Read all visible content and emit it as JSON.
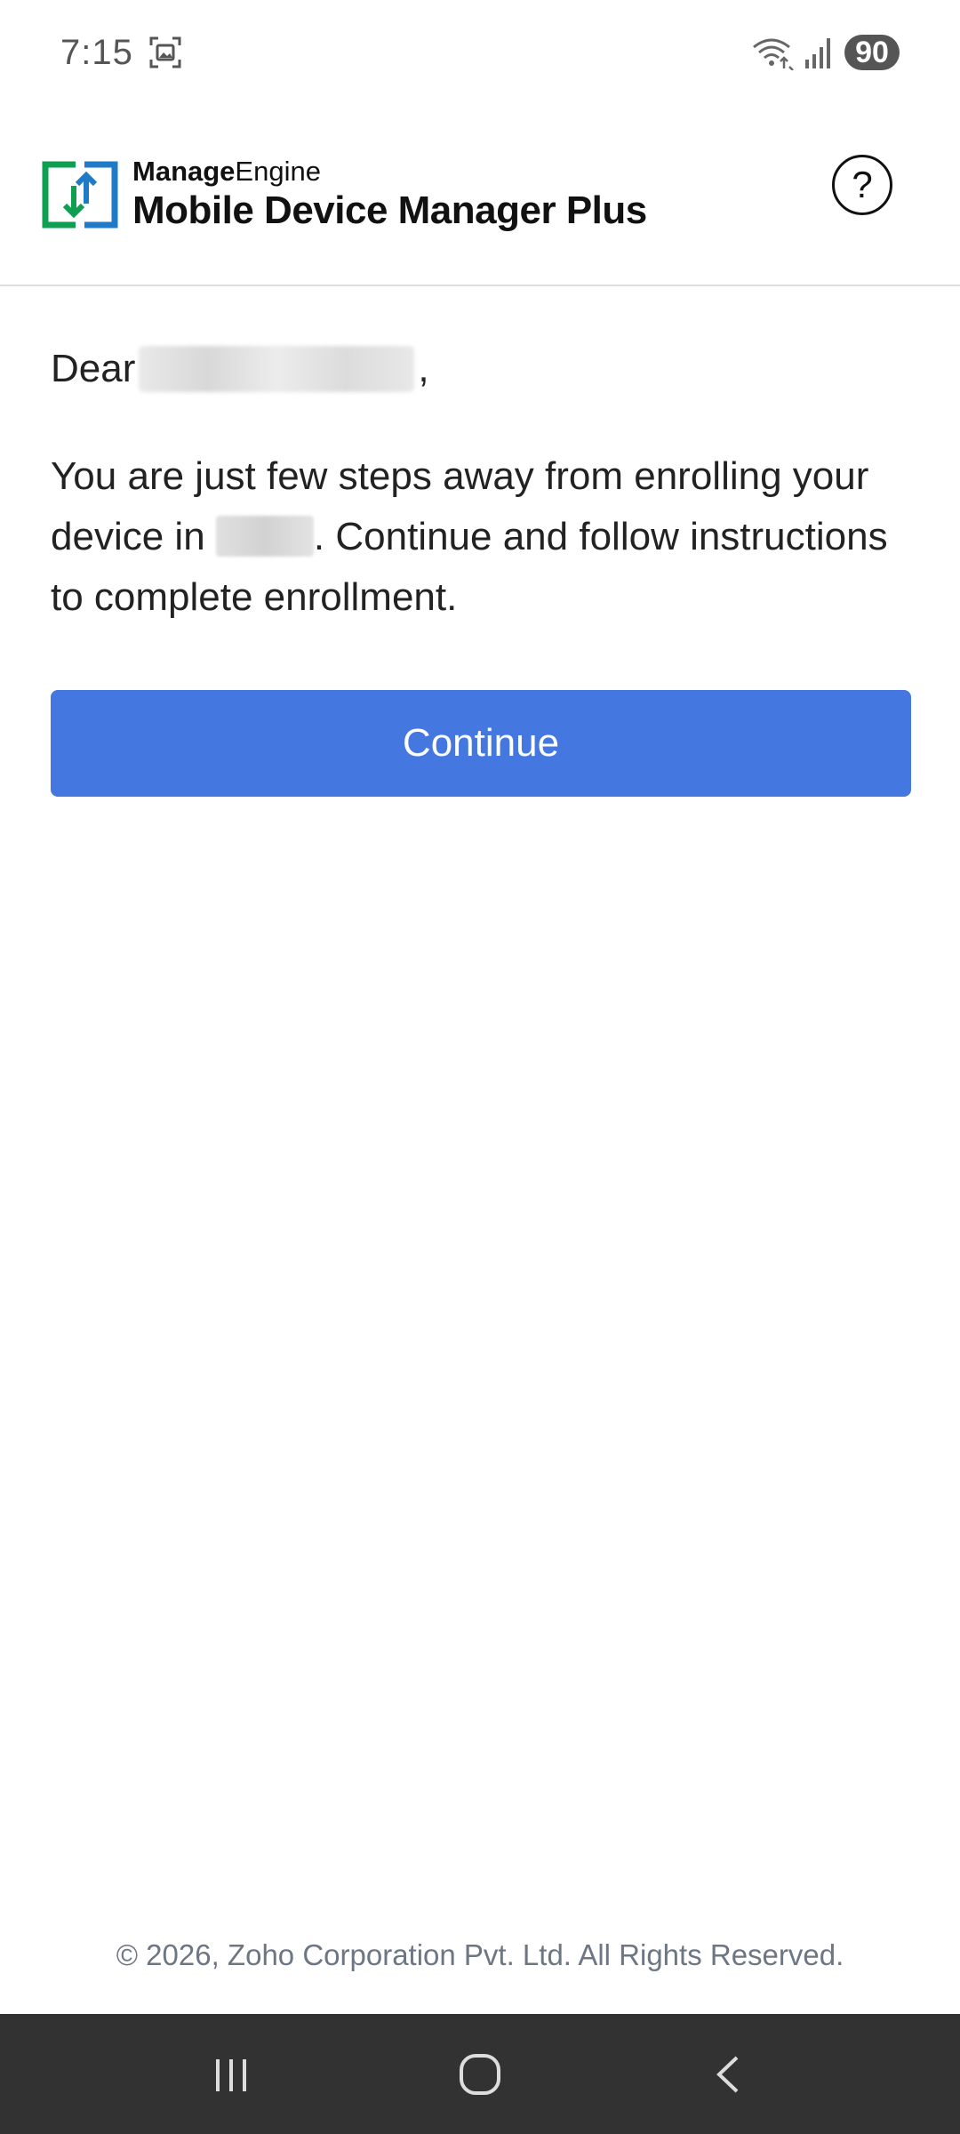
{
  "status_bar": {
    "time": "7:15",
    "battery": "90",
    "icons": [
      "screenshot-icon",
      "wifi-icon",
      "signal-icon"
    ]
  },
  "header": {
    "brand_top_bold": "Manage",
    "brand_top_rest": "Engine",
    "brand_bottom": "Mobile Device Manager Plus",
    "help_label": "?",
    "brand_colors": {
      "green": "#0f9f50",
      "blue": "#1f7ac8"
    }
  },
  "content": {
    "greeting_prefix": "Dear",
    "greeting_suffix": ",",
    "message_part1": "You are just few steps away from enrolling your device in",
    "message_part2": ". Continue and follow instructions to complete enrollment.",
    "continue_label": "Continue",
    "accent": "#4477e0"
  },
  "footer": {
    "copyright": "© 2026, Zoho Corporation Pvt. Ltd. All Rights Reserved."
  },
  "nav_bar": {
    "buttons": [
      "recent-apps-icon",
      "home-icon",
      "back-icon"
    ]
  }
}
